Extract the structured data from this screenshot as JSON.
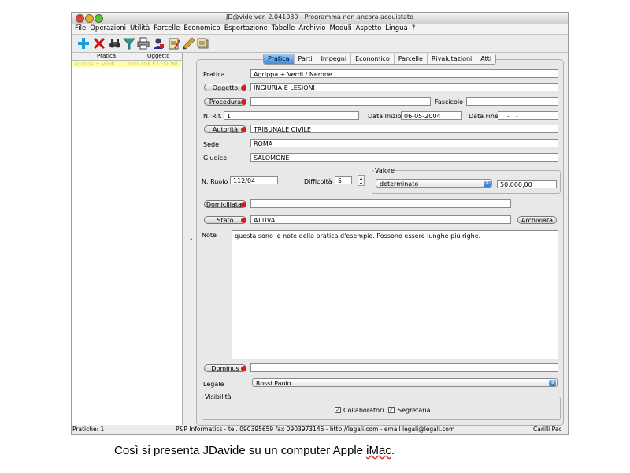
{
  "window": {
    "title": "JD@vide ver. 2.041030 - Programma non ancora acquistato"
  },
  "menu": [
    "File",
    "Operazioni",
    "Utilità",
    "Parcelle",
    "Economico",
    "Esportazione",
    "Tabelle",
    "Archivio",
    "Moduli",
    "Aspetto",
    "Lingua",
    "?"
  ],
  "toolbar": {
    "icons": [
      "add-icon",
      "delete-icon",
      "binoculars-icon",
      "filter-icon",
      "print-icon",
      "user-icon",
      "document-edit-icon",
      "pen-icon",
      "export-icon"
    ]
  },
  "list": {
    "columns": [
      "Pratica",
      "Oggetto"
    ],
    "rows": [
      {
        "pratica": "Agrippa + Verdi ...",
        "oggetto": "INGIURIA E LESIONI"
      }
    ]
  },
  "tabs": [
    {
      "label": "Pratica",
      "active": true
    },
    {
      "label": "Parti",
      "active": false
    },
    {
      "label": "Impegni",
      "active": false
    },
    {
      "label": "Economico",
      "active": false
    },
    {
      "label": "Parcelle",
      "active": false
    },
    {
      "label": "Rivalutazioni",
      "active": false
    },
    {
      "label": "Atti",
      "active": false
    }
  ],
  "form": {
    "pratica_label": "Pratica",
    "pratica_value": "Agrippa + Verdi / Nerone",
    "oggetto_label": "Oggetto",
    "oggetto_value": "INGIURIA E LESIONI",
    "procedura_label": "Procedura",
    "procedura_value": "",
    "fascicolo_label": "Fascicolo",
    "fascicolo_value": "",
    "nrif_label": "N. Rif.",
    "nrif_value": "1",
    "data_inizio_label": "Data Inizio",
    "data_inizio_value": "06-05-2004",
    "data_fine_label": "Data Fine",
    "data_fine_value": "__-__-____",
    "autorita_label": "Autorità",
    "autorita_value": "TRIBUNALE CIVILE",
    "sede_label": "Sede",
    "sede_value": "ROMA",
    "giudice_label": "Giudice",
    "giudice_value": "SALOMONE",
    "nruolo_label": "N. Ruolo",
    "nruolo_value": "112/04",
    "difficolta_label": "Difficoltà",
    "difficolta_value": "5",
    "valore_label": "Valore",
    "valore_type": "determinato",
    "valore_amount": "50.000,00",
    "domiciliatario_label": "Domiciliatar",
    "domiciliatario_value": "",
    "stato_label": "Stato",
    "stato_value": "ATTIVA",
    "archivia_label": "Archiviata",
    "note_label": "Note",
    "note_value": "questa sono le note della pratica d'esempio. Possono essere lunghe più righe.",
    "dominus_label": "Dominus",
    "dominus_value": "",
    "legale_label": "Legale",
    "legale_value": "Rossi Paolo",
    "visibilita_label": "Visibilità",
    "collaboratori_label": "Collaboratori",
    "collaboratori_checked": true,
    "segretaria_label": "Segretaria",
    "segretaria_checked": true
  },
  "status": {
    "count": "Pratiche: 1",
    "center": "P&P Informatics - tel. 090395659 fax 0903973146 - http://legali.com - email legali@legali.com",
    "user": "Carilli Pac"
  },
  "caption": {
    "before": "Così si presenta JDavide su un computer Apple ",
    "underlined": "iMac",
    "after": "."
  },
  "colors": {
    "accent": "#3d8fe0",
    "row_highlight": "#ffffa8",
    "bullet_red": "#d02020"
  }
}
